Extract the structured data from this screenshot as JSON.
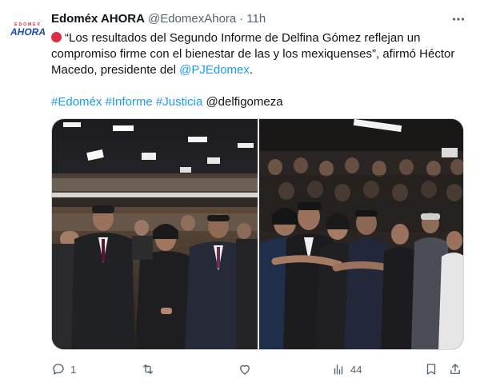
{
  "account": {
    "avatar_top": "EDOMEX",
    "avatar_main": "AHORA",
    "name": "Edoméx AHORA",
    "handle": "@EdomexAhora",
    "separator": "·",
    "time": "11h"
  },
  "tweet": {
    "text_main": "“Los resultados del Segundo Informe de Delfina Gómez reflejan un compromiso firme con el bienestar de las y los mexiquenses”, afirmó Héctor Macedo, presidente del ",
    "text_link": "@PJEdomex",
    "text_end": ".",
    "hashtags": [
      "#Edoméx",
      "#Informe",
      "#Justicia"
    ],
    "mention": "@delfigomeza"
  },
  "media": {
    "photos": [
      "event-photo-left",
      "event-photo-right"
    ]
  },
  "actions": {
    "reply_count": "1",
    "retweet_count": "",
    "like_count": "",
    "views_count": "44"
  },
  "colors": {
    "link": "#1d9bf0",
    "muted": "#536471",
    "text": "#0f1419",
    "emoji_red": "#dd2e44"
  }
}
